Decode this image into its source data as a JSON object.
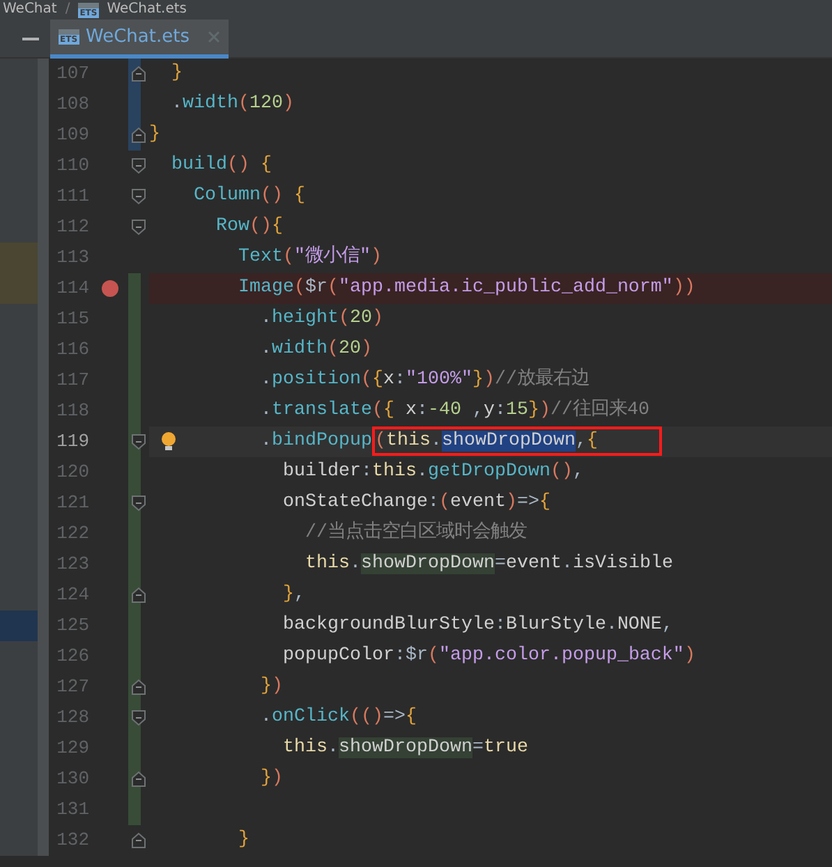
{
  "breadcrumb": {
    "separator": "/",
    "items": [
      {
        "label": "WeChat"
      },
      {
        "label": "WeChat.ets",
        "file_badge": "ETS"
      }
    ]
  },
  "tabs": [
    {
      "label": "WeChat.ets",
      "file_badge": "ETS",
      "selected": true
    }
  ],
  "lines": [
    {
      "number": "107",
      "fold_end": true,
      "change_marker": {
        "color": "#29425e"
      },
      "tokens": [
        {
          "text": "  }",
          "kind": "brace"
        }
      ]
    },
    {
      "number": "108",
      "change_marker": {
        "color": "#29425e"
      },
      "tokens": [
        {
          "text": "  .",
          "kind": "plain"
        },
        {
          "text": "width",
          "kind": "fn"
        },
        {
          "text": "(",
          "kind": "paren"
        },
        {
          "text": "120",
          "kind": "num"
        },
        {
          "text": ")",
          "kind": "paren"
        }
      ]
    },
    {
      "number": "109",
      "fold_end": true,
      "change_marker": {
        "color": "#29425e"
      },
      "tokens": [
        {
          "text": "}",
          "kind": "brace"
        }
      ]
    },
    {
      "number": "110",
      "fold_start": true,
      "tokens": [
        {
          "text": "  build",
          "kind": "fn"
        },
        {
          "text": "()",
          "kind": "paren"
        },
        {
          "text": " {",
          "kind": "brace"
        }
      ]
    },
    {
      "number": "111",
      "fold_start": true,
      "tokens": [
        {
          "text": "    Column",
          "kind": "fn"
        },
        {
          "text": "()",
          "kind": "paren"
        },
        {
          "text": " {",
          "kind": "brace"
        }
      ]
    },
    {
      "number": "112",
      "fold_start": true,
      "tokens": [
        {
          "text": "      Row",
          "kind": "fn"
        },
        {
          "text": "()",
          "kind": "paren"
        },
        {
          "text": "{",
          "kind": "brace"
        }
      ]
    },
    {
      "number": "113",
      "side_marker": {
        "color": "#4a4632"
      },
      "tokens": [
        {
          "text": "        Text",
          "kind": "fn"
        },
        {
          "text": "(",
          "kind": "paren"
        },
        {
          "text": "\"微小信\"",
          "kind": "str"
        },
        {
          "text": ")",
          "kind": "paren"
        }
      ]
    },
    {
      "number": "114",
      "side_marker": {
        "color": "#4a4632"
      },
      "breakpoint": true,
      "change_marker": {
        "color": "#384c38"
      },
      "tokens": [
        {
          "text": "        Image",
          "kind": "fn"
        },
        {
          "text": "(",
          "kind": "paren"
        },
        {
          "text": "$r",
          "kind": "plain"
        },
        {
          "text": "(",
          "kind": "paren"
        },
        {
          "text": "\"app.media.ic_public_add_norm\"",
          "kind": "str"
        },
        {
          "text": "))",
          "kind": "paren"
        }
      ]
    },
    {
      "number": "115",
      "change_marker": {
        "color": "#384c38"
      },
      "tokens": [
        {
          "text": "          .",
          "kind": "plain"
        },
        {
          "text": "height",
          "kind": "fn"
        },
        {
          "text": "(",
          "kind": "paren"
        },
        {
          "text": "20",
          "kind": "num"
        },
        {
          "text": ")",
          "kind": "paren"
        }
      ]
    },
    {
      "number": "116",
      "change_marker": {
        "color": "#384c38"
      },
      "tokens": [
        {
          "text": "          .",
          "kind": "plain"
        },
        {
          "text": "width",
          "kind": "fn"
        },
        {
          "text": "(",
          "kind": "paren"
        },
        {
          "text": "20",
          "kind": "num"
        },
        {
          "text": ")",
          "kind": "paren"
        }
      ]
    },
    {
      "number": "117",
      "change_marker": {
        "color": "#384c38"
      },
      "tokens": [
        {
          "text": "          .",
          "kind": "plain"
        },
        {
          "text": "position",
          "kind": "fn"
        },
        {
          "text": "(",
          "kind": "paren"
        },
        {
          "text": "{",
          "kind": "brace"
        },
        {
          "text": "x",
          "kind": "prop"
        },
        {
          "text": ":",
          "kind": "plain"
        },
        {
          "text": "\"100%\"",
          "kind": "str"
        },
        {
          "text": "}",
          "kind": "brace"
        },
        {
          "text": ")",
          "kind": "paren"
        },
        {
          "text": "//放最右边",
          "kind": "comment"
        }
      ]
    },
    {
      "number": "118",
      "change_marker": {
        "color": "#384c38"
      },
      "tokens": [
        {
          "text": "          .",
          "kind": "plain"
        },
        {
          "text": "translate",
          "kind": "fn"
        },
        {
          "text": "(",
          "kind": "paren"
        },
        {
          "text": "{",
          "kind": "brace"
        },
        {
          "text": " x",
          "kind": "prop"
        },
        {
          "text": ":",
          "kind": "plain"
        },
        {
          "text": "-40",
          "kind": "num"
        },
        {
          "text": " ,",
          "kind": "plain"
        },
        {
          "text": "y",
          "kind": "prop"
        },
        {
          "text": ":",
          "kind": "plain"
        },
        {
          "text": "15",
          "kind": "num"
        },
        {
          "text": "}",
          "kind": "brace"
        },
        {
          "text": ")",
          "kind": "paren"
        },
        {
          "text": "//往回来40",
          "kind": "comment"
        }
      ]
    },
    {
      "number": "119",
      "current": true,
      "intention_bulb": true,
      "fold_start": true,
      "change_marker": {
        "color": "#384c38"
      },
      "tokens": [
        {
          "text": "          .",
          "kind": "plain"
        },
        {
          "text": "bindPopup",
          "kind": "fn"
        },
        {
          "text": "(",
          "kind": "paren",
          "boxed": true
        },
        {
          "text": "this",
          "kind": "keyword",
          "boxed": true
        },
        {
          "text": ".",
          "kind": "plain",
          "boxed": true
        },
        {
          "text": "showDropDown",
          "kind": "prop",
          "selected": true,
          "boxed": true
        },
        {
          "text": ",",
          "kind": "plain",
          "boxed": true
        },
        {
          "text": "{",
          "kind": "brace",
          "boxed": true
        }
      ]
    },
    {
      "number": "120",
      "change_marker": {
        "color": "#384c38"
      },
      "tokens": [
        {
          "text": "            builder",
          "kind": "prop"
        },
        {
          "text": ":",
          "kind": "plain"
        },
        {
          "text": "this",
          "kind": "keyword"
        },
        {
          "text": ".",
          "kind": "plain"
        },
        {
          "text": "getDropDown",
          "kind": "fn"
        },
        {
          "text": "()",
          "kind": "paren"
        },
        {
          "text": ",",
          "kind": "plain"
        }
      ]
    },
    {
      "number": "121",
      "fold_start": true,
      "change_marker": {
        "color": "#384c38"
      },
      "tokens": [
        {
          "text": "            onStateChange",
          "kind": "prop"
        },
        {
          "text": ":",
          "kind": "plain"
        },
        {
          "text": "(",
          "kind": "paren"
        },
        {
          "text": "event",
          "kind": "prop"
        },
        {
          "text": ")",
          "kind": "paren"
        },
        {
          "text": "=>",
          "kind": "plain"
        },
        {
          "text": "{",
          "kind": "brace"
        }
      ]
    },
    {
      "number": "122",
      "change_marker": {
        "color": "#384c38"
      },
      "tokens": [
        {
          "text": "              //当点击空白区域时会触发",
          "kind": "comment"
        }
      ]
    },
    {
      "number": "123",
      "change_marker": {
        "color": "#384c38"
      },
      "tokens": [
        {
          "text": "              this",
          "kind": "keyword"
        },
        {
          "text": ".",
          "kind": "plain"
        },
        {
          "text": "showDropDown",
          "kind": "prop",
          "highlight": true
        },
        {
          "text": "=",
          "kind": "plain"
        },
        {
          "text": "event",
          "kind": "prop"
        },
        {
          "text": ".",
          "kind": "plain"
        },
        {
          "text": "isVisible",
          "kind": "prop"
        }
      ]
    },
    {
      "number": "124",
      "fold_end": true,
      "change_marker": {
        "color": "#384c38"
      },
      "tokens": [
        {
          "text": "            }",
          "kind": "brace"
        },
        {
          "text": ",",
          "kind": "plain"
        }
      ]
    },
    {
      "number": "125",
      "side_marker": {
        "color": "#203550"
      },
      "change_marker": {
        "color": "#384c38"
      },
      "tokens": [
        {
          "text": "            backgroundBlurStyle",
          "kind": "prop"
        },
        {
          "text": ":",
          "kind": "plain"
        },
        {
          "text": "BlurStyle",
          "kind": "prop"
        },
        {
          "text": ".",
          "kind": "plain"
        },
        {
          "text": "NONE",
          "kind": "prop"
        },
        {
          "text": ",",
          "kind": "plain"
        }
      ]
    },
    {
      "number": "126",
      "change_marker": {
        "color": "#384c38"
      },
      "tokens": [
        {
          "text": "            popupColor",
          "kind": "prop"
        },
        {
          "text": ":",
          "kind": "plain"
        },
        {
          "text": "$r",
          "kind": "plain"
        },
        {
          "text": "(",
          "kind": "paren"
        },
        {
          "text": "\"app.color.popup_back\"",
          "kind": "str"
        },
        {
          "text": ")",
          "kind": "paren"
        }
      ]
    },
    {
      "number": "127",
      "fold_end": true,
      "change_marker": {
        "color": "#384c38"
      },
      "tokens": [
        {
          "text": "          }",
          "kind": "brace"
        },
        {
          "text": ")",
          "kind": "paren"
        }
      ]
    },
    {
      "number": "128",
      "fold_start": true,
      "change_marker": {
        "color": "#384c38"
      },
      "tokens": [
        {
          "text": "          .",
          "kind": "plain"
        },
        {
          "text": "onClick",
          "kind": "fn"
        },
        {
          "text": "(()",
          "kind": "paren"
        },
        {
          "text": "=>",
          "kind": "plain"
        },
        {
          "text": "{",
          "kind": "brace"
        }
      ]
    },
    {
      "number": "129",
      "change_marker": {
        "color": "#384c38"
      },
      "tokens": [
        {
          "text": "            this",
          "kind": "keyword"
        },
        {
          "text": ".",
          "kind": "plain"
        },
        {
          "text": "showDropDown",
          "kind": "prop",
          "highlight": true
        },
        {
          "text": "=",
          "kind": "plain"
        },
        {
          "text": "true",
          "kind": "keyword"
        }
      ]
    },
    {
      "number": "130",
      "fold_end": true,
      "change_marker": {
        "color": "#384c38"
      },
      "tokens": [
        {
          "text": "          }",
          "kind": "brace"
        },
        {
          "text": ")",
          "kind": "paren"
        }
      ]
    },
    {
      "number": "131",
      "change_marker": {
        "color": "#384c38"
      }
    },
    {
      "number": "132",
      "fold_end": true,
      "tokens": [
        {
          "text": "        }",
          "kind": "brace"
        }
      ]
    }
  ]
}
